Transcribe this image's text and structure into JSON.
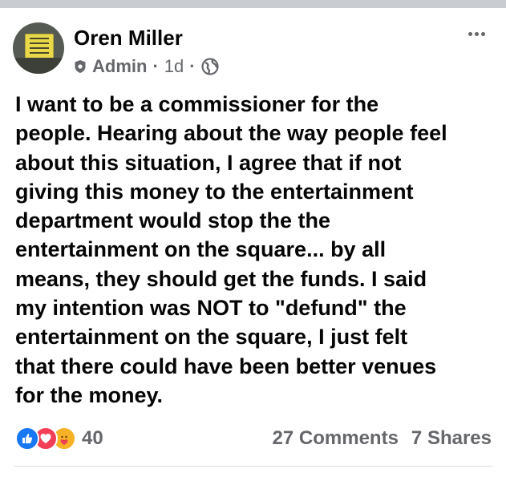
{
  "post": {
    "author": "Oren Miller",
    "role": "Admin",
    "time": "1d",
    "separator": "·",
    "text_lines": [
      "I want to be a commissioner for the",
      "people. Hearing about the way people feel",
      "about this situation, I agree that if not",
      "giving this money to the entertainment",
      "department would stop the the",
      "entertainment on the square... by all",
      "means, they should get the funds. I said",
      "my intention was NOT to \"defund\" the",
      "entertainment on the square, I just felt",
      "that there could have been better venues",
      "for the money."
    ]
  },
  "reactions": {
    "count": "40",
    "types": [
      "like-icon",
      "love-icon",
      "care-icon"
    ]
  },
  "counts": {
    "comments": "27 Comments",
    "shares": "7 Shares"
  },
  "icons": {
    "admin": "shield-icon",
    "audience": "globe-icon",
    "menu": "more-options-icon"
  },
  "colors": {
    "secondary_text": "#65676b",
    "like_blue": "#1877f2",
    "love_red": "#f33e58",
    "care_yellow": "#f7b125"
  }
}
